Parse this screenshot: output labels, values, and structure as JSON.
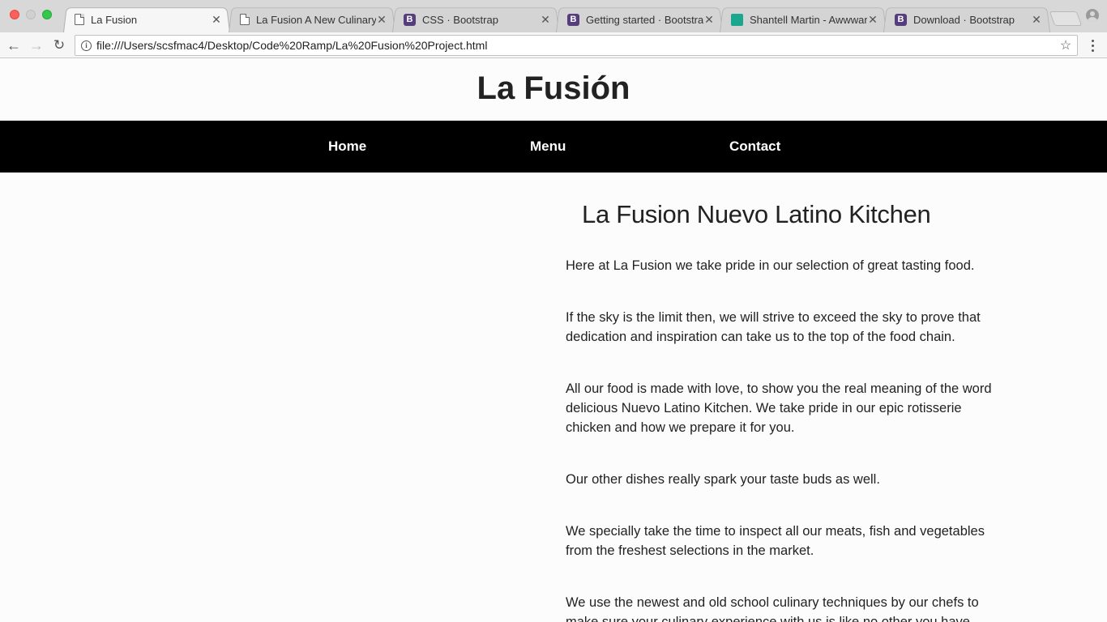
{
  "browser": {
    "tabs": [
      {
        "title": "La Fusion",
        "favicon": "page-icon",
        "active": true
      },
      {
        "title": "La Fusion A New Culinary",
        "favicon": "page-icon",
        "active": false
      },
      {
        "title": "CSS · Bootstrap",
        "favicon": "bootstrap-icon",
        "active": false
      },
      {
        "title": "Getting started · Bootstrap",
        "favicon": "bootstrap-icon",
        "active": false
      },
      {
        "title": "Shantell Martin - Awwwards",
        "favicon": "awwwards-icon",
        "active": false
      },
      {
        "title": "Download · Bootstrap",
        "favicon": "bootstrap-icon",
        "active": false
      }
    ],
    "close_glyph": "✕",
    "url": "file:///Users/scsfmac4/Desktop/Code%20Ramp/La%20Fusion%20Project.html"
  },
  "site": {
    "title": "La Fusión",
    "nav": [
      {
        "label": "Home"
      },
      {
        "label": "Menu"
      },
      {
        "label": "Contact"
      }
    ]
  },
  "main": {
    "heading": "La Fusion Nuevo Latino Kitchen",
    "paragraphs": [
      "Here at La Fusion we take pride in our selection of great tasting food.",
      "If the sky is the limit then, we will strive to exceed the sky to prove that dedication and inspiration can take us to the top of the food chain.",
      "All our food is made with love, to show you the real meaning of the word delicious Nuevo Latino Kitchen. We take pride in our epic rotisserie chicken and how we prepare it for you.",
      "Our other dishes really spark your taste buds as well.",
      "We specially take the time to inspect all our meats, fish and vegetables from the freshest selections in the market.",
      "We use the newest and old school culinary techniques by our chefs to make sure your culinary experience with us is like no other you have"
    ]
  },
  "colors": {
    "nav_background": "#000000",
    "bootstrap_purple": "#563d7c",
    "page_background": "#fcfcfc"
  }
}
